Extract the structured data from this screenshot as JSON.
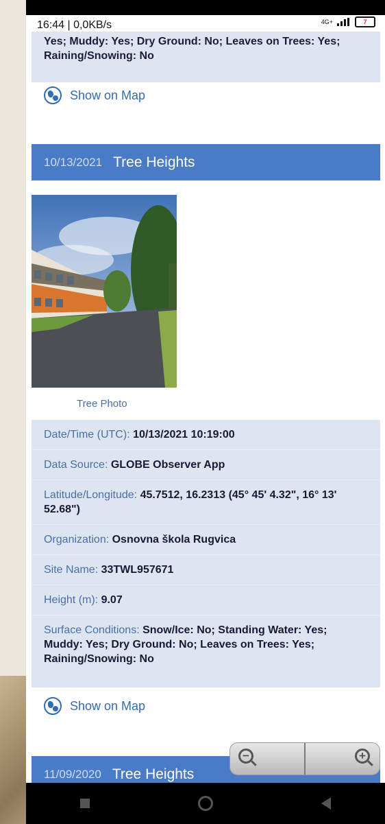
{
  "status": {
    "time_speed": "16:44 | 0,0KB/s",
    "network": "4G+",
    "battery": "7"
  },
  "top_panel": {
    "surface_text": "Yes; Muddy: Yes; Dry Ground: No; Leaves on Trees: Yes; Raining/Snowing: No"
  },
  "map_link_label": "Show on Map",
  "entry1": {
    "date": "10/13/2021",
    "title": "Tree Heights",
    "photo_caption": "Tree Photo",
    "rows": [
      {
        "label": "Date/Time (UTC): ",
        "value": "10/13/2021 10:19:00"
      },
      {
        "label": "Data Source: ",
        "value": "GLOBE Observer App"
      },
      {
        "label": "Latitude/Longitude: ",
        "value": "45.7512, 16.2313 (45° 45' 4.32\", 16° 13' 52.68\")"
      },
      {
        "label": "Organization: ",
        "value": "Osnovna škola Rugvica"
      },
      {
        "label": "Site Name: ",
        "value": "33TWL957671"
      },
      {
        "label": "Height (m): ",
        "value": "9.07"
      },
      {
        "label": "Surface Conditions: ",
        "value": "Snow/Ice: No; Standing Water: Yes; Muddy: Yes; Dry Ground: No; Leaves on Trees: Yes; Raining/Snowing: No"
      }
    ]
  },
  "entry2": {
    "date": "11/09/2020",
    "title": "Tree Heights"
  },
  "colors": {
    "header": "#4a7bc7",
    "panel": "#dde5f0",
    "link": "#3769b0"
  },
  "icons": [
    "globe-icon",
    "zoom-out-icon",
    "zoom-in-icon",
    "nav-recents-icon",
    "nav-home-icon",
    "nav-back-icon"
  ]
}
